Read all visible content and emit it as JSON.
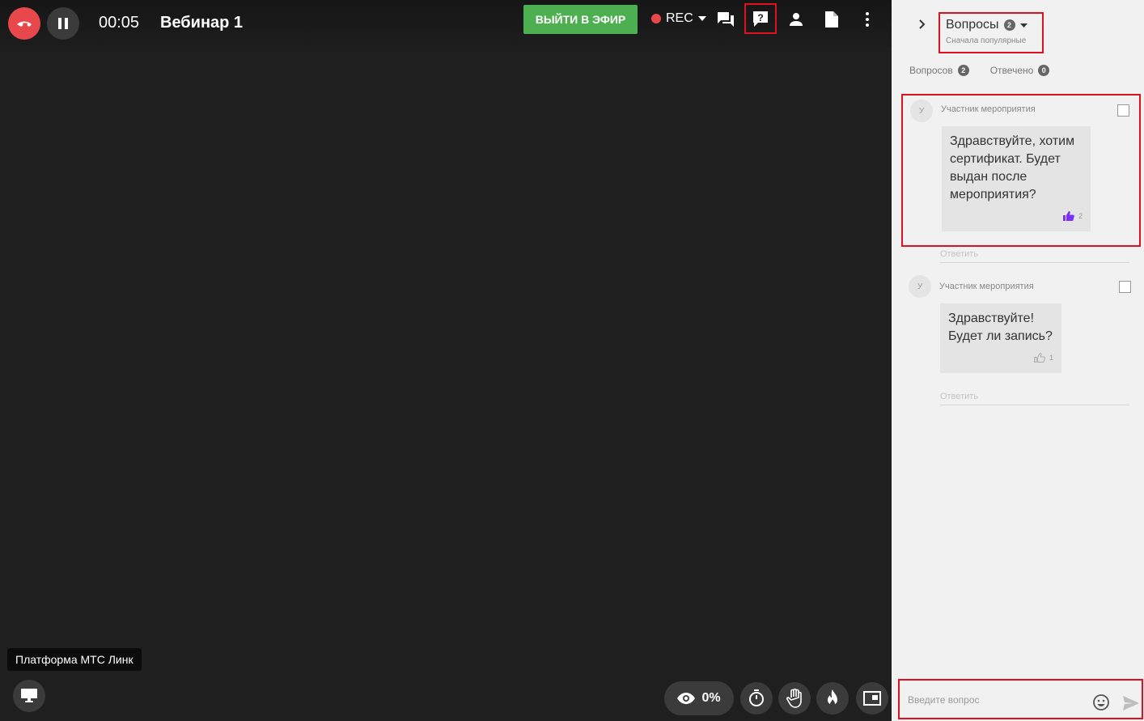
{
  "header": {
    "timer": "00:05",
    "title": "Вебинар 1",
    "on_air_label": "ВЫЙТИ В ЭФИР",
    "rec_label": "REC"
  },
  "icons": {
    "end_call": "phone-hangup-icon",
    "pause": "pause-icon",
    "rec_dropdown": "caret-down-icon",
    "chat": "chat-icon",
    "questions": "question-icon",
    "participants": "person-icon",
    "files": "file-icon",
    "more": "more-vertical-icon",
    "screen": "monitor-icon",
    "viewers": "eye-icon",
    "timer": "stopwatch-icon",
    "hand": "hand-icon",
    "reactions": "fire-icon",
    "layout": "picture-in-picture-icon",
    "collapse": "chevron-right-icon",
    "like": "thumbs-up-icon",
    "emoji": "emoji-icon",
    "send": "send-icon"
  },
  "stage": {
    "brand_label": "Платформа МТС Линк",
    "viewers_percent": "0%"
  },
  "panel": {
    "title": "Вопросы",
    "title_count": "2",
    "sort_label": "Сначала популярные",
    "tabs": [
      {
        "label": "Вопросов",
        "count": "2"
      },
      {
        "label": "Отвечено",
        "count": "0"
      }
    ],
    "questions": [
      {
        "avatar": "У",
        "author": "Участник мероприятия",
        "text": "Здравствуйте, хотим сертификат. Будет выдан после мероприятия?",
        "likes": "2",
        "liked": true,
        "reply_label": "Ответить"
      },
      {
        "avatar": "У",
        "author": "Участник мероприятия",
        "text": "Здравствуйте! Будет ли запись?",
        "likes": "1",
        "liked": false,
        "reply_label": "Ответить"
      }
    ],
    "input_placeholder": "Введите вопрос"
  },
  "colors": {
    "accent_red": "#e8484c",
    "on_air_green": "#4caf50",
    "highlight": "#e0101e",
    "like_active": "#7b2ff7"
  }
}
